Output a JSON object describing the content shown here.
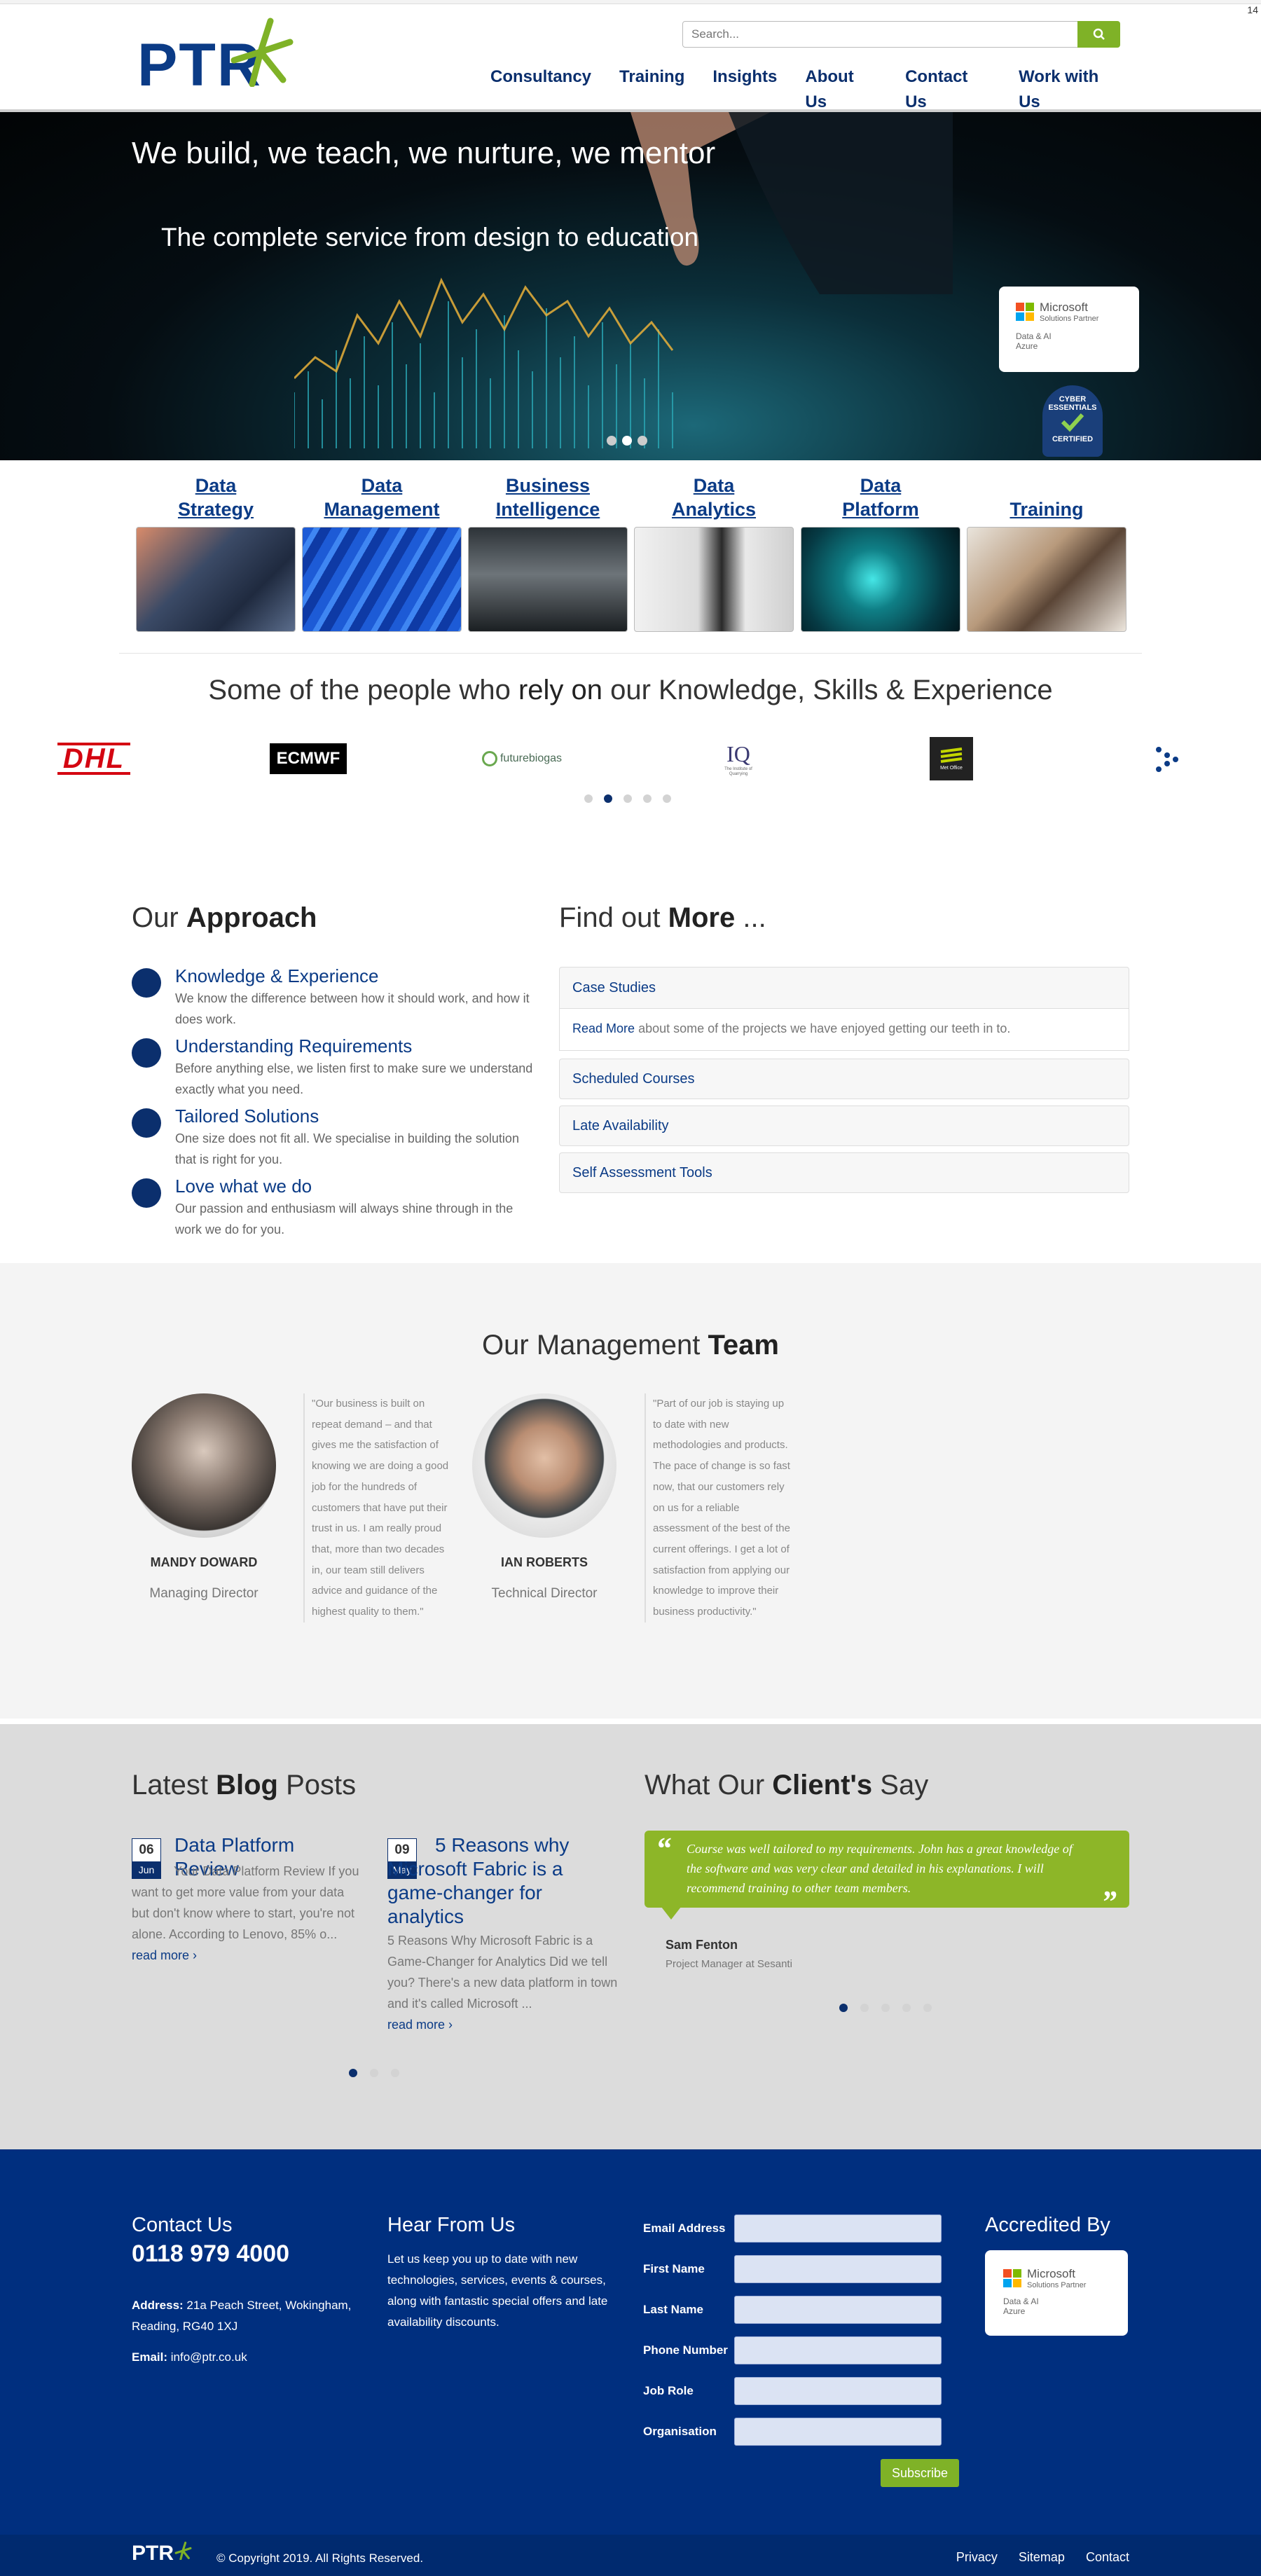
{
  "page": {
    "corner_number": "14"
  },
  "brand": {
    "logo_text": "PTR",
    "accent": "#7fb227",
    "primary": "#0b2f6d"
  },
  "search": {
    "placeholder": "Search..."
  },
  "nav": {
    "items": [
      "Consultancy",
      "Training",
      "Insights",
      "About Us",
      "Contact Us",
      "Work with Us"
    ]
  },
  "hero": {
    "headline": "We build, we teach, we nurture, we mentor",
    "subline": "The complete service from design to education",
    "ms_badge": {
      "title": "Microsoft",
      "subtitle": "Solutions Partner",
      "line1": "Data & AI",
      "line2": "Azure"
    },
    "cyber_badge": {
      "line1": "CYBER",
      "line2": "ESSENTIALS",
      "line3": "CERTIFIED"
    }
  },
  "services": [
    {
      "line1": "Data",
      "line2": "Strategy"
    },
    {
      "line1": "Data",
      "line2": "Management"
    },
    {
      "line1": "Business",
      "line2": "Intelligence"
    },
    {
      "line1": "Data",
      "line2": "Analytics"
    },
    {
      "line1": "Data",
      "line2": "Platform"
    },
    {
      "line1": "",
      "line2": "Training"
    }
  ],
  "clients": {
    "title_pre": "Some of the people who",
    "title_bold": "rely on",
    "title_post": "our Knowledge, Skills & Experience",
    "logos": [
      "DHL",
      "ECMWF",
      "futurebiogas",
      "IQ",
      "Met Office"
    ],
    "iq_sub": "The Institute of Quarrying",
    "met_sub": "Met Office",
    "dots_active": 1
  },
  "approach": {
    "title_pre": "Our",
    "title_bold": "Approach",
    "items": [
      {
        "title": "Knowledge & Experience",
        "text": "We know the difference between how it should work, and how it does work."
      },
      {
        "title": "Understanding Requirements",
        "text": "Before anything else, we listen first to make sure we understand exactly what you need."
      },
      {
        "title": "Tailored Solutions",
        "text": "One size does not fit all. We specialise in building the solution that is right for you."
      },
      {
        "title": "Love what we do",
        "text": "Our passion and enthusiasm will always shine through in the work we do for you."
      }
    ]
  },
  "findout": {
    "title_pre": "Find out",
    "title_bold": "More",
    "title_post": "...",
    "panels": [
      "Case Studies",
      "Scheduled Courses",
      "Late Availability",
      "Self Assessment Tools"
    ],
    "case_link": "Read More",
    "case_text": "about some of the projects we have enjoyed getting our teeth in to."
  },
  "team": {
    "title_pre": "Our Management",
    "title_bold": "Team",
    "members": [
      {
        "name": "MANDY DOWARD",
        "role": "Managing Director",
        "quote": "\"Our business is built on repeat demand – and that gives me the satisfaction of knowing we are doing a good job for the hundreds of customers that have put their trust in us. I am really proud that, more than two decades in, our team still delivers advice and guidance of the highest quality to them.\""
      },
      {
        "name": "IAN ROBERTS",
        "role": "Technical Director",
        "quote": "\"Part of our job is staying up to date with new methodologies and products. The pace of change is so fast now, that our customers rely on us for a reliable assessment of the best of the current offerings. I get a lot of satisfaction from applying our knowledge to improve their business productivity.\""
      }
    ]
  },
  "blog": {
    "title_pre": "Latest",
    "title_bold": "Blog",
    "title_post": "Posts",
    "posts": [
      {
        "day": "06",
        "month": "Jun",
        "title": "Data Platform Review",
        "text": "Your Data Platform Review If you want to get more value from your data but don't know where to start, you're not alone. According to Lenovo, 85% o...",
        "more": "read more ›"
      },
      {
        "day": "09",
        "month": "May",
        "title": "5 Reasons why Microsoft Fabric is a game-changer for analytics",
        "text": "5 Reasons Why Microsoft Fabric is a Game-Changer for Analytics Did we tell you? There's a new data platform in town and it's called Microsoft ...",
        "more": "read more ›"
      }
    ]
  },
  "testimonials": {
    "title_pre": "What Our",
    "title_bold": "Client's",
    "title_post": "Say",
    "quote": "Course was well tailored to my requirements. John has a great knowledge of the software and was very clear and detailed in his explanations. I will recommend training to other team members.",
    "author": "Sam Fenton",
    "author_role": "Project Manager at Sesanti"
  },
  "footer": {
    "contact_title": "Contact Us",
    "phone": "0118 979 4000",
    "address_label": "Address:",
    "address": "21a Peach Street, Wokingham, Reading, RG40 1XJ",
    "email_label": "Email:",
    "email": "info@ptr.co.uk",
    "hear_title": "Hear From Us",
    "hear_text": "Let us keep you up to date with new technologies, services, events & courses, along with fantastic special offers and late availability discounts.",
    "form_fields": [
      "Email Address",
      "First Name",
      "Last Name",
      "Phone Number",
      "Job Role",
      "Organisation"
    ],
    "subscribe": "Subscribe",
    "accredited_title": "Accredited By",
    "copyright": "© Copyright 2019. All Rights Reserved.",
    "links": [
      "Privacy",
      "Sitemap",
      "Contact"
    ]
  }
}
